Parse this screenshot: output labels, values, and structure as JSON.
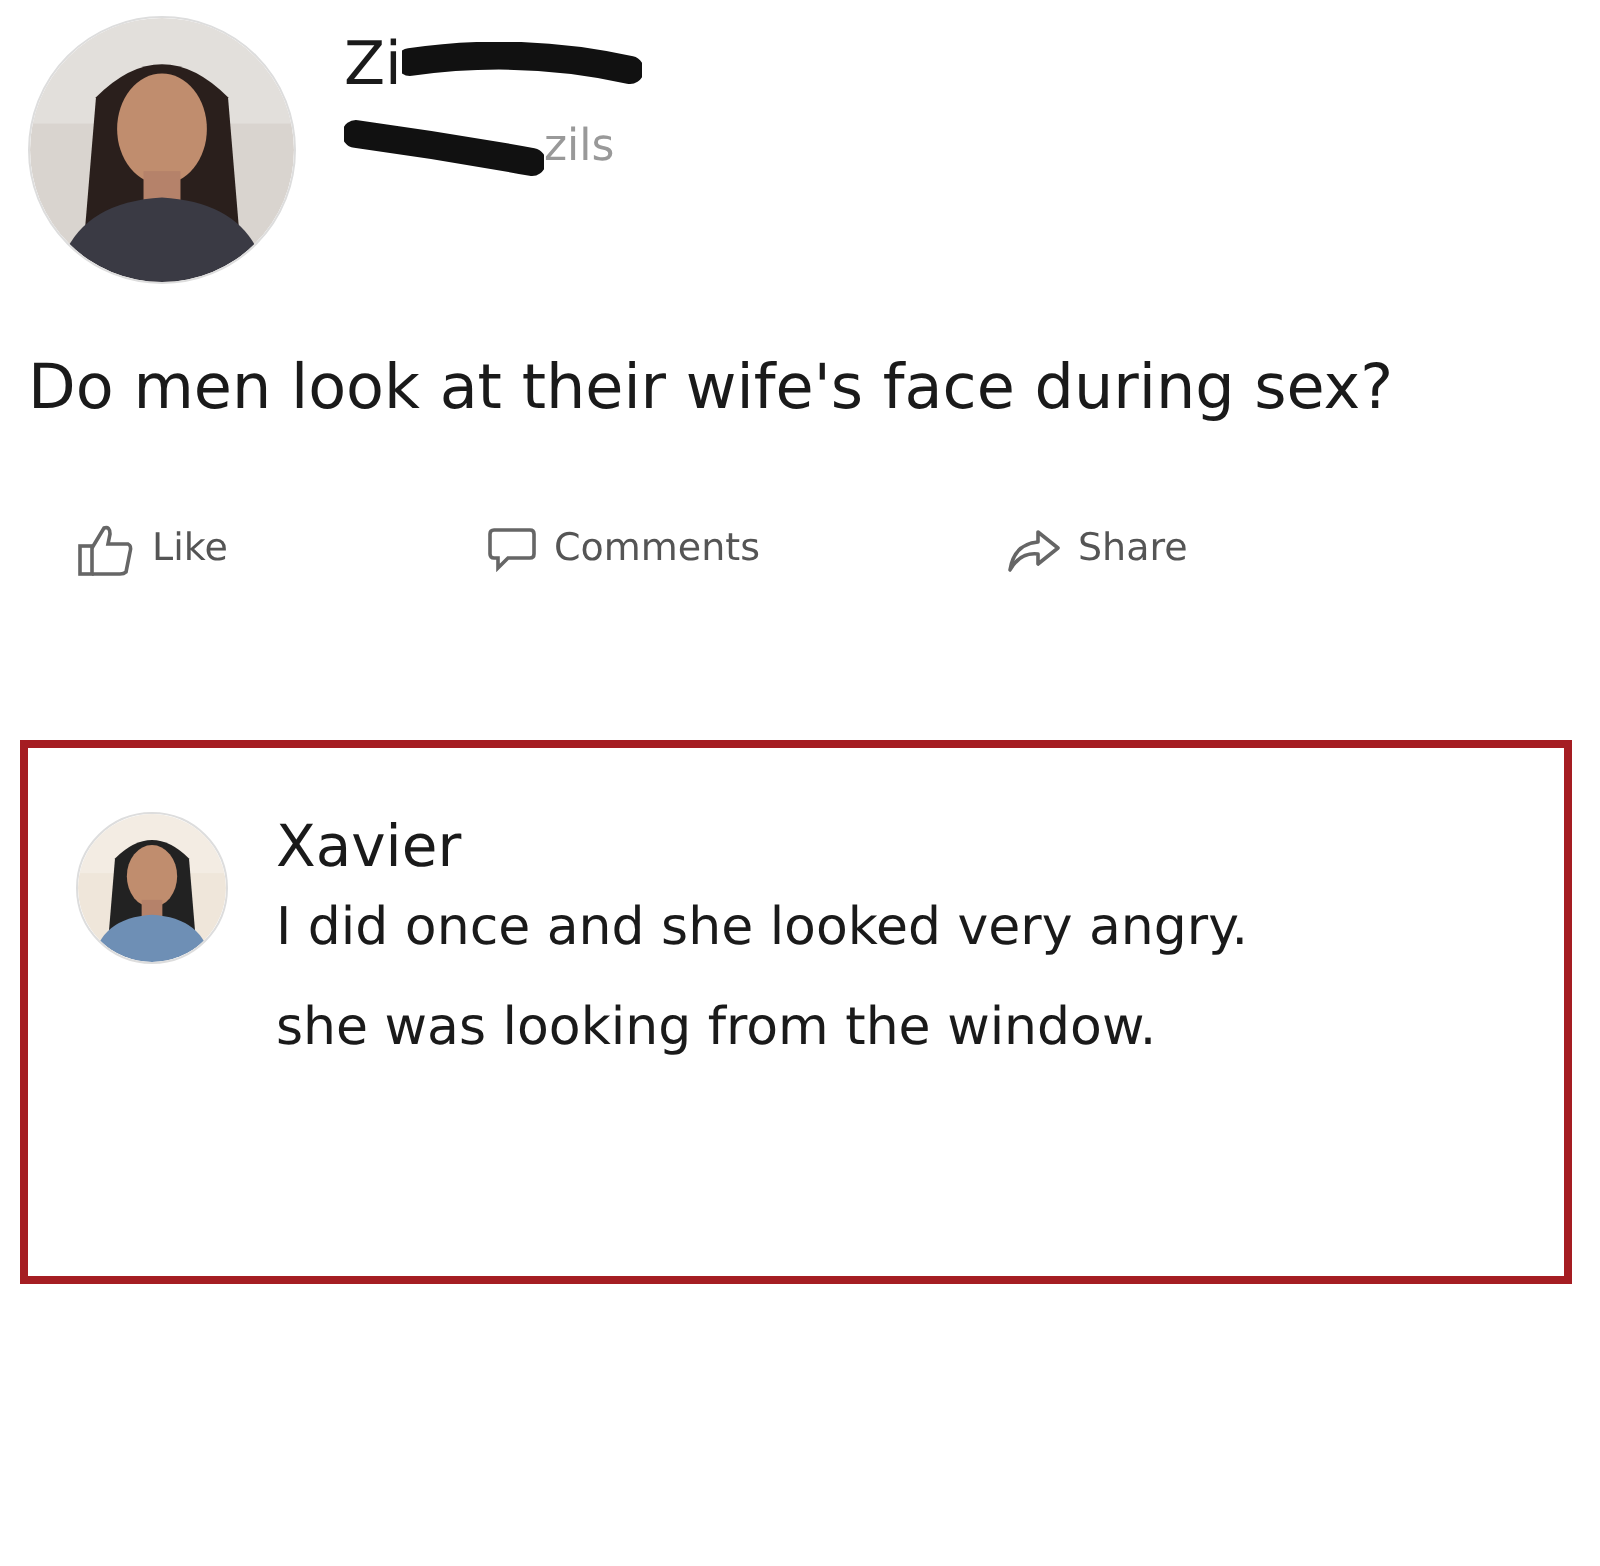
{
  "post": {
    "author": {
      "name": "Zi",
      "handle": "zils"
    },
    "text": "Do men look at their wife's face during sex?",
    "actions": [
      {
        "kind": "like",
        "label": "Like"
      },
      {
        "kind": "comment",
        "label": "Comments"
      },
      {
        "kind": "share",
        "label": "Share"
      }
    ]
  },
  "comment": {
    "author": "Xavier",
    "lines": [
      "I did once and she looked very angry.",
      "she was looking from the window."
    ]
  }
}
